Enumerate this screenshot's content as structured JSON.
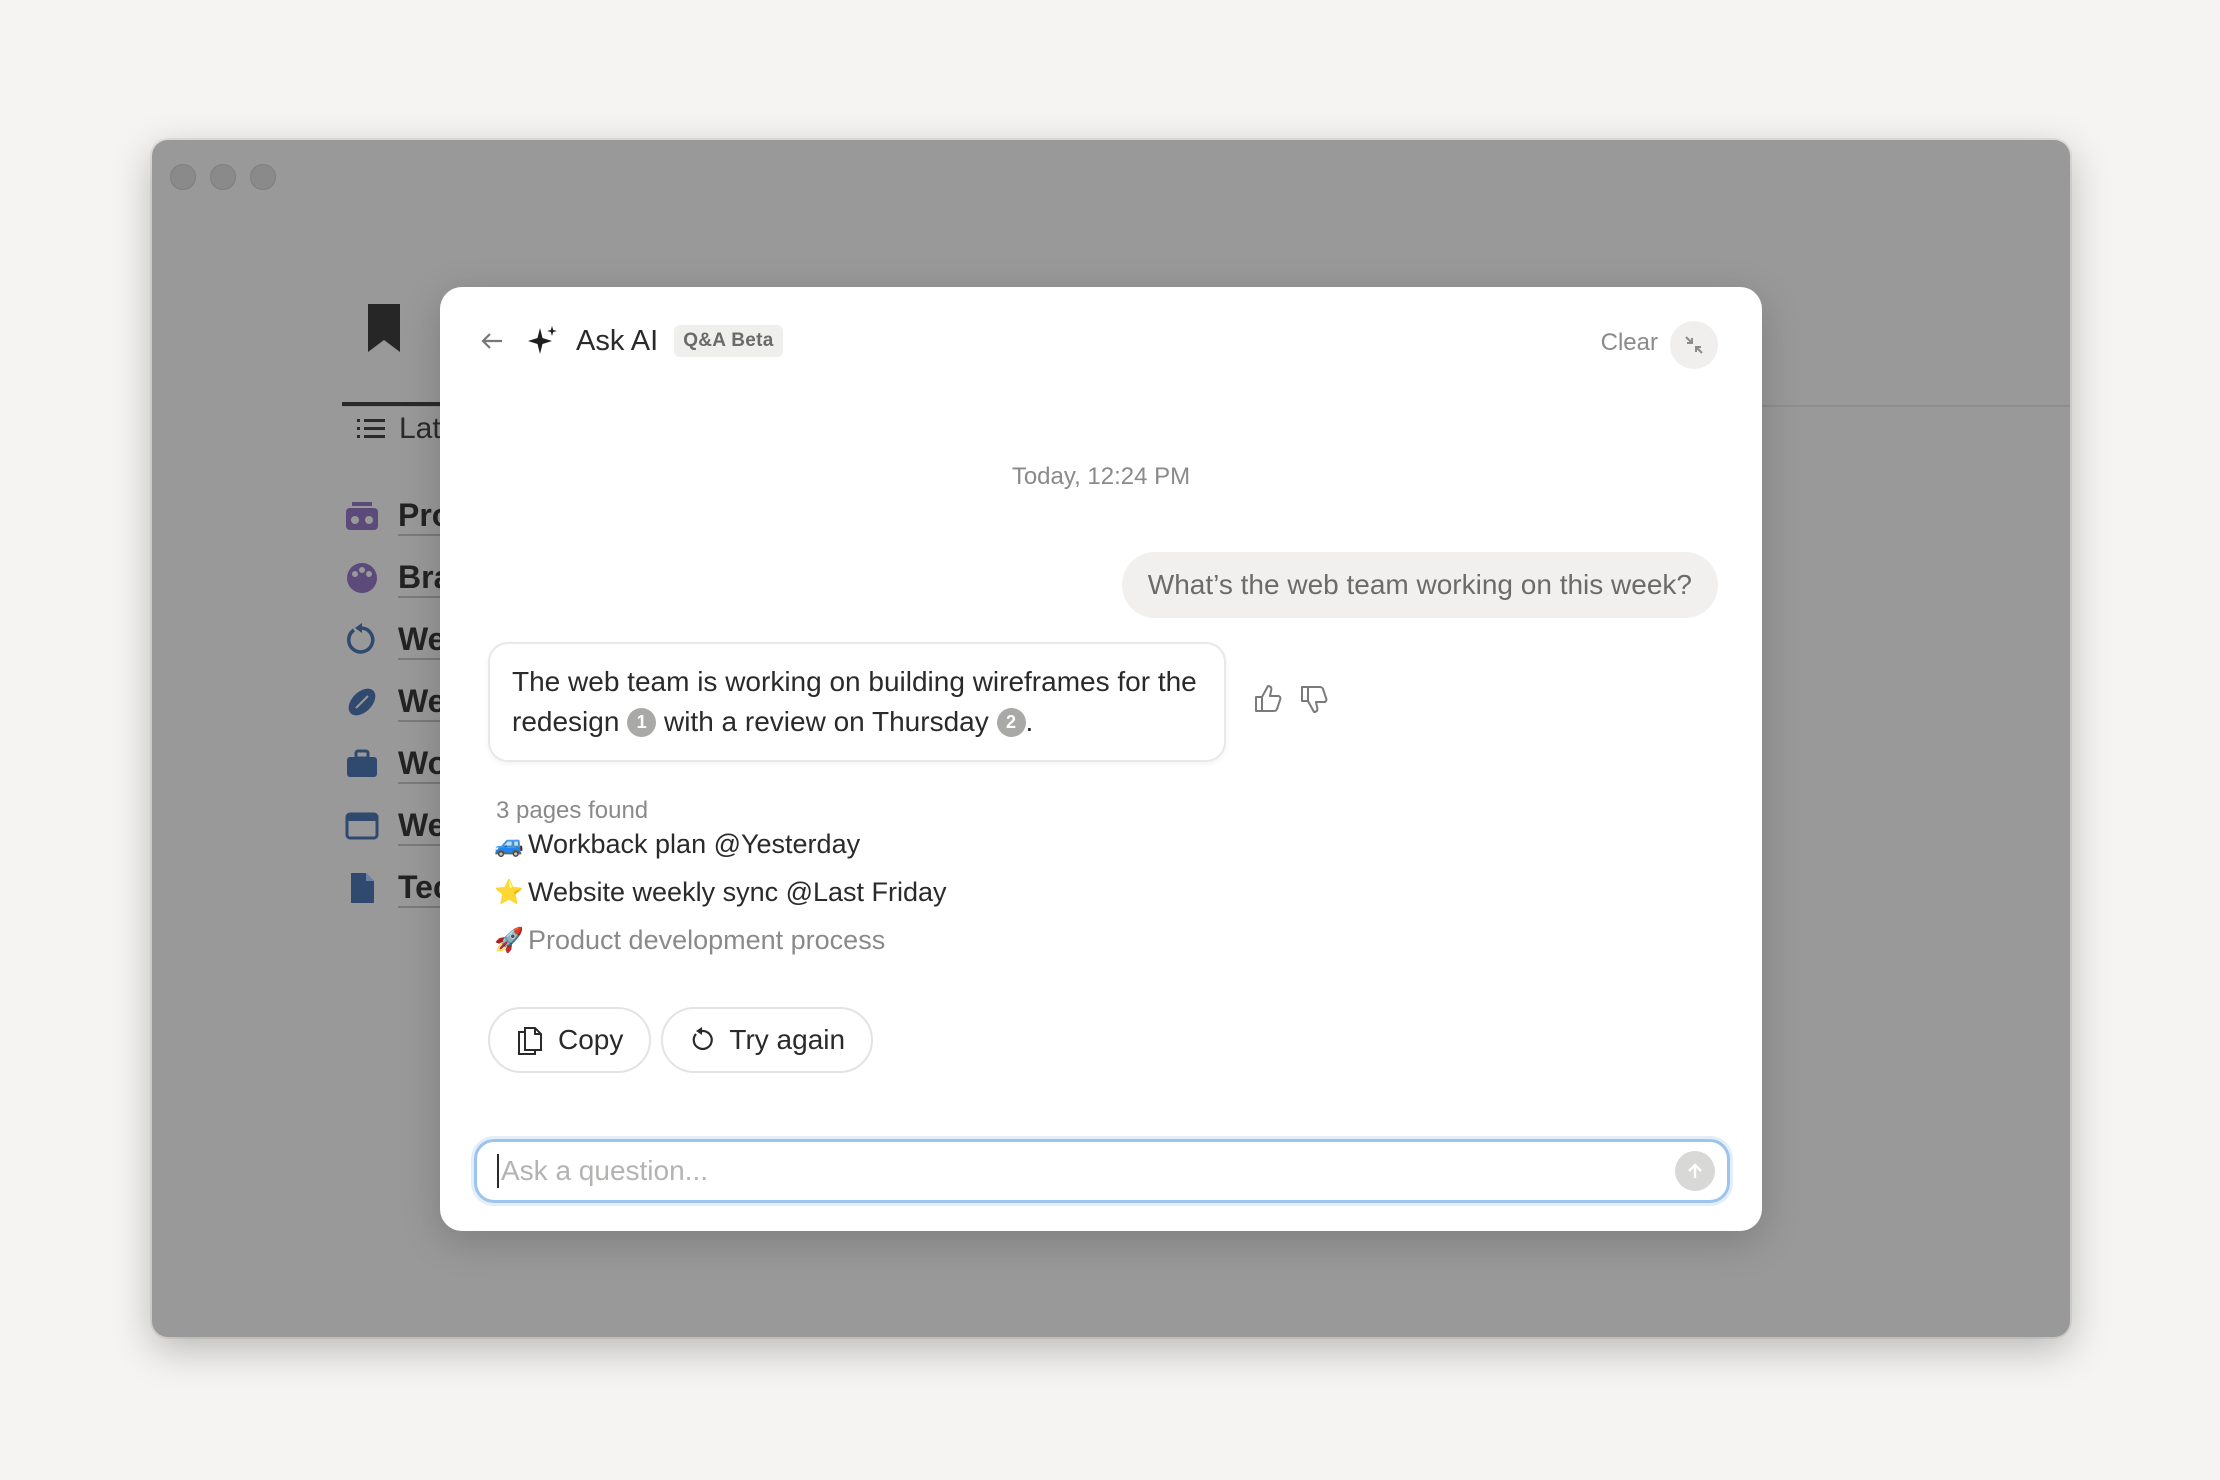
{
  "background_page": {
    "tab_label": "Lat",
    "pages": [
      {
        "label": "Pro",
        "icon": "radio-icon"
      },
      {
        "label": "Bra",
        "icon": "palette-icon"
      },
      {
        "label": "We",
        "icon": "refresh-icon"
      },
      {
        "label": "We",
        "icon": "football-icon"
      },
      {
        "label": "Wo",
        "icon": "briefcase-icon"
      },
      {
        "label": "We",
        "icon": "browser-icon"
      },
      {
        "label": "Tec",
        "icon": "document-icon"
      }
    ]
  },
  "modal": {
    "title": "Ask AI",
    "badge": "Q&A Beta",
    "clear_label": "Clear"
  },
  "conversation": {
    "timestamp": "Today, 12:24 PM",
    "user_message": "What’s the web team working on this week?",
    "ai_response": {
      "part1": "The web team is working on building wireframes for the redesign",
      "cite1": "1",
      "part2": "with a review on Thursday",
      "cite2": "2",
      "part3": "."
    }
  },
  "sources": {
    "count_label": "3 pages found",
    "items": [
      {
        "emoji": "🚙",
        "label": "Workback plan @Yesterday"
      },
      {
        "emoji": "⭐",
        "label": "Website weekly sync @Last Friday"
      },
      {
        "emoji": "🚀",
        "label": "Product development process"
      }
    ]
  },
  "actions": {
    "copy_label": "Copy",
    "try_again_label": "Try again"
  },
  "input": {
    "placeholder": "Ask a question...",
    "value": ""
  },
  "colors": {
    "accent_focus": "#9cc4ec",
    "overlay": "#999999",
    "page_bg": "#f5f4f2"
  }
}
